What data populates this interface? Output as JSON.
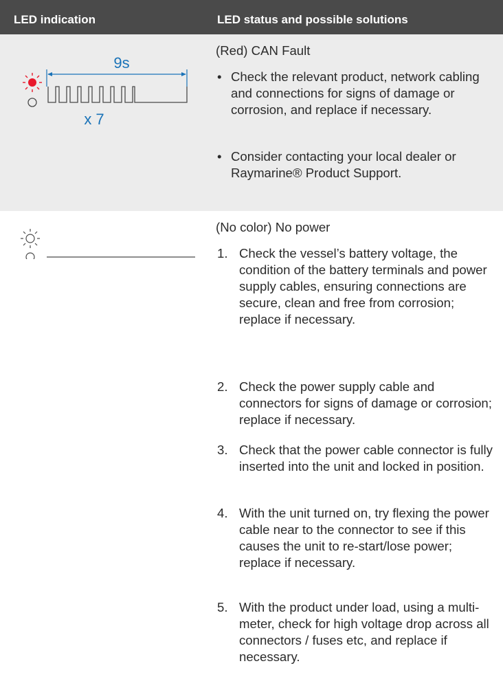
{
  "header": {
    "col1": "LED indication",
    "col2": "LED status and possible solutions"
  },
  "colors": {
    "header_bg": "#4a4a4a",
    "row_alt_bg": "#ececec",
    "led_red": "#e8192c",
    "diagram_blue": "#1a73b8"
  },
  "rows": [
    {
      "diagram": {
        "duration": "9s",
        "repeat": "x 7",
        "led_top": "red-led-icon",
        "led_bottom": "off-led-icon"
      },
      "status": "(Red) CAN Fault",
      "bullets": [
        "Check the relevant product, network cabling and connections for signs of damage or corrosion, and replace if necessary.",
        "Consider contacting your local dealer or Raymarine® Product Support."
      ]
    },
    {
      "diagram": {
        "led_top": "no-color-led-icon",
        "led_bottom": "off-led-icon"
      },
      "status": "(No color) No power",
      "steps": [
        {
          "num": "1.",
          "text": "Check the vessel’s battery voltage, the condition of the battery terminals and power supply cables, ensuring connections are secure, clean and free from corrosion; replace if necessary."
        },
        {
          "num": "2.",
          "text": "Check the power supply cable and connectors for signs of damage or corrosion; replace if necessary."
        },
        {
          "num": "3.",
          "text": "Check that the power cable connector is fully inserted into the unit and locked in position."
        },
        {
          "num": "4.",
          "text": "With the unit turned on, try flexing the power cable near to the connector to see if this causes the unit to re-start/lose power; replace if necessary."
        },
        {
          "num": "5.",
          "text": "With the product under load, using a multi-meter, check for high voltage drop across all connectors / fuses etc, and replace if necessary."
        }
      ]
    }
  ]
}
